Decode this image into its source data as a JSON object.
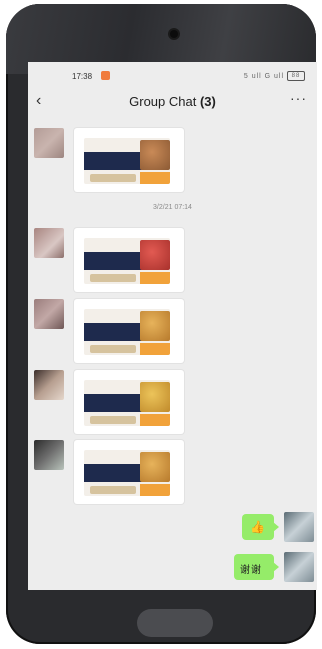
{
  "status": {
    "time": "17:38",
    "signal": "5 ull G ull",
    "battery": "88"
  },
  "header": {
    "back_icon": "back-chevron-icon",
    "title": "Group Chat",
    "count": "(3)",
    "more_icon": "more-dots-icon"
  },
  "chat": {
    "timestamp": "3/2/21 07:14",
    "sent_messages": [
      {
        "type": "emoji",
        "icon": "thumbs-up-icon"
      },
      {
        "type": "text",
        "text": "谢谢"
      }
    ]
  },
  "colors": {
    "sent_bubble": "#95ec69",
    "chat_background": "#ededed",
    "notification": "#f07b3c"
  }
}
